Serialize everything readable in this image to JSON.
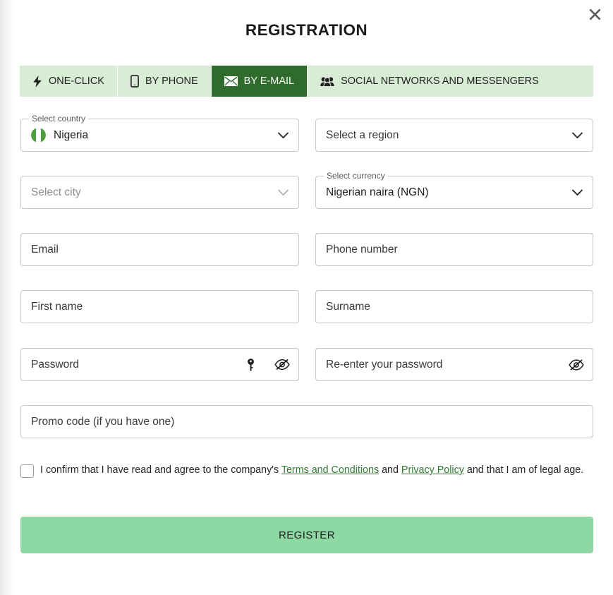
{
  "header": {
    "title": "REGISTRATION",
    "close_icon": "close-icon"
  },
  "tabs": [
    {
      "label": "ONE-CLICK",
      "icon": "lightning-bolt-icon",
      "active": false
    },
    {
      "label": "BY PHONE",
      "icon": "mobile-phone-icon",
      "active": false
    },
    {
      "label": "BY E-MAIL",
      "icon": "envelope-icon",
      "active": true
    },
    {
      "label": "SOCIAL NETWORKS AND MESSENGERS",
      "icon": "people-group-icon",
      "active": false
    }
  ],
  "form": {
    "country": {
      "label": "Select country",
      "value": "Nigeria",
      "flag": "nigeria-flag-icon"
    },
    "region": {
      "placeholder": "Select a region",
      "value": ""
    },
    "city": {
      "placeholder": "Select city",
      "value": ""
    },
    "currency": {
      "label": "Select currency",
      "value": "Nigerian naira (NGN)"
    },
    "email": {
      "placeholder": "Email",
      "value": ""
    },
    "phone": {
      "placeholder": "Phone number",
      "value": ""
    },
    "first_name": {
      "placeholder": "First name",
      "value": ""
    },
    "surname": {
      "placeholder": "Surname",
      "value": ""
    },
    "password": {
      "placeholder": "Password",
      "value": "",
      "key_icon": "key-icon",
      "toggle_icon": "eye-off-icon"
    },
    "password_confirm": {
      "placeholder": "Re-enter your password",
      "value": "",
      "toggle_icon": "eye-off-icon"
    },
    "promo_code": {
      "placeholder": "Promo code (if you have one)",
      "value": ""
    }
  },
  "consent": {
    "checked": false,
    "text_before": "I confirm that I have read and agree to the company's ",
    "link_terms": "Terms and Conditions",
    "text_middle": " and ",
    "link_privacy": "Privacy Policy",
    "text_after": " and that I am of legal age."
  },
  "submit": {
    "label": "REGISTER"
  },
  "colors": {
    "tab_bar_background": "#d9ecd6",
    "tab_active_background": "#2f6b2b",
    "link_green": "#2f7d32",
    "submit_green": "#8ed9a3",
    "field_border": "#c7c7c7"
  }
}
